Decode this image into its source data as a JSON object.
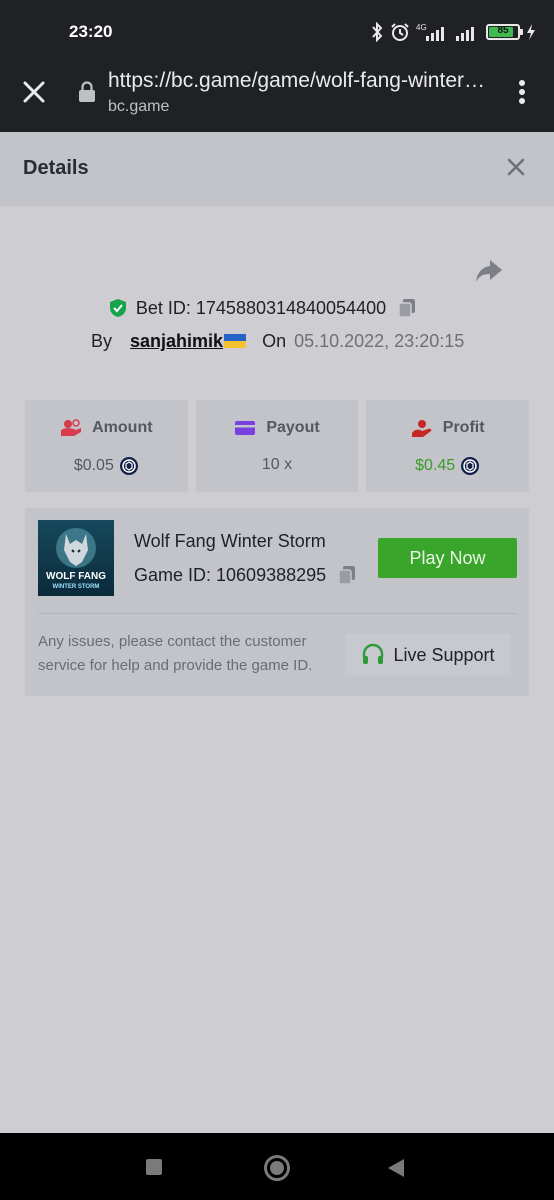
{
  "status_bar": {
    "time": "23:20",
    "network": "4G",
    "battery": "85",
    "battery_level": 0.85
  },
  "browser": {
    "url": "https://bc.game/game/wolf-fang-winter-storm",
    "domain": "bc.game"
  },
  "details": {
    "title": "Details",
    "bet_id": "Bet ID: 1745880314840054400",
    "by_label": "By",
    "username": "sanjahimik",
    "on_label": "On",
    "datetime": "05.10.2022, 23:20:15"
  },
  "stats": [
    {
      "label": "Amount",
      "value": "$0.05",
      "icon": "amount-icon",
      "color": "#d63b4e"
    },
    {
      "label": "Payout",
      "value": "10 x",
      "icon": "payout-icon",
      "color": "#7a3fe0"
    },
    {
      "label": "Profit",
      "value": "$0.45",
      "icon": "profit-icon",
      "color": "#c62828"
    }
  ],
  "game": {
    "name": "Wolf Fang Winter Storm",
    "game_id": "Game ID: 10609388295",
    "thumb_line1": "WOLF FANG",
    "thumb_line2": "WINTER STORM",
    "play_label": "Play Now",
    "notice": "Any issues, please contact the customer service for help and provide the game ID.",
    "support_label": "Live Support"
  },
  "colors": {
    "accent_green": "#3aa52b",
    "profit_green": "#3a9b2a",
    "shield_green": "#16a34a"
  }
}
